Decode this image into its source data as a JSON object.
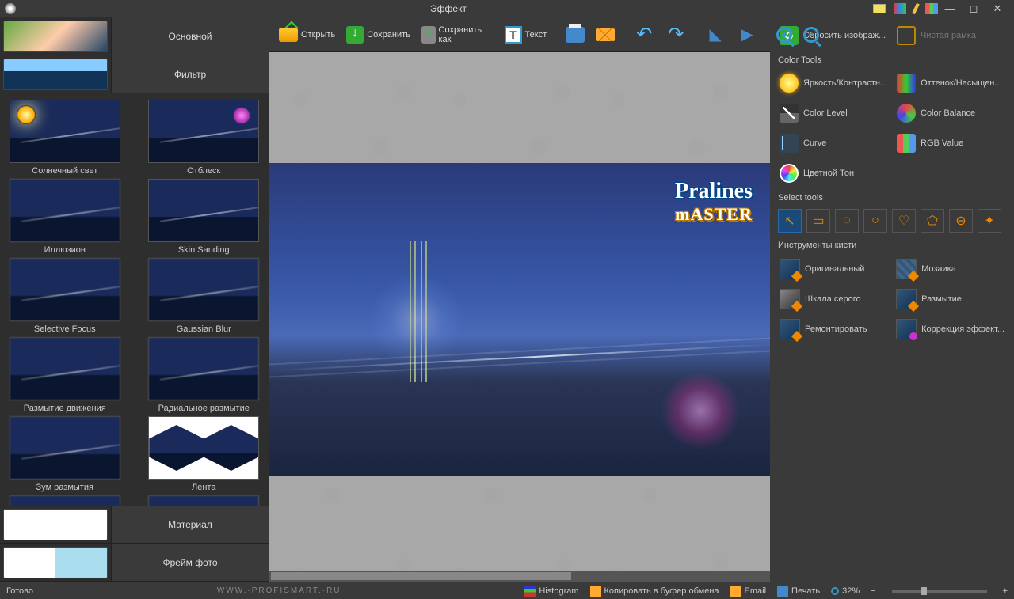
{
  "title": "Эффект",
  "toolbar": {
    "open": "Открыть",
    "save": "Сохранить",
    "saveas": "Сохранить как",
    "text": "Текст"
  },
  "left_tabs": {
    "main": "Основной",
    "filter": "Фильтр",
    "material": "Материал",
    "frame": "Фрейм фото"
  },
  "filters": [
    "Солнечный свет",
    "Отблеск",
    "Иллюзион",
    "Skin Sanding",
    "Selective Focus",
    "Gaussian Blur",
    "Размытие движения",
    "Радиальное размытие",
    "Зум размытия",
    "Лента"
  ],
  "watermark": {
    "l1": "Pralines",
    "l2": "mASTER"
  },
  "right": {
    "reset": "Сбросить изображ...",
    "clean_frame": "Чистая рамка",
    "color_tools": "Color Tools",
    "brightness": "Яркость/Контрастн...",
    "hue": "Оттенок/Насыщен...",
    "level": "Color Level",
    "balance": "Color Balance",
    "curve": "Curve",
    "rgb": "RGB Value",
    "tone": "Цветной Тон",
    "select_tools": "Select tools",
    "brush_tools": "Инструменты кисти",
    "brush": {
      "orig": "Оригинальный",
      "mosaic": "Мозаика",
      "gray": "Шкала серого",
      "blur": "Размытие",
      "repair": "Ремонтировать",
      "fx": "Коррекция эффект..."
    }
  },
  "status": {
    "ready": "Готово",
    "site": "WWW.-PROFISMART.-RU",
    "histogram": "Histogram",
    "clipboard": "Копировать в буфер обмена",
    "email": "Email",
    "print": "Печать",
    "zoom": "32%"
  }
}
